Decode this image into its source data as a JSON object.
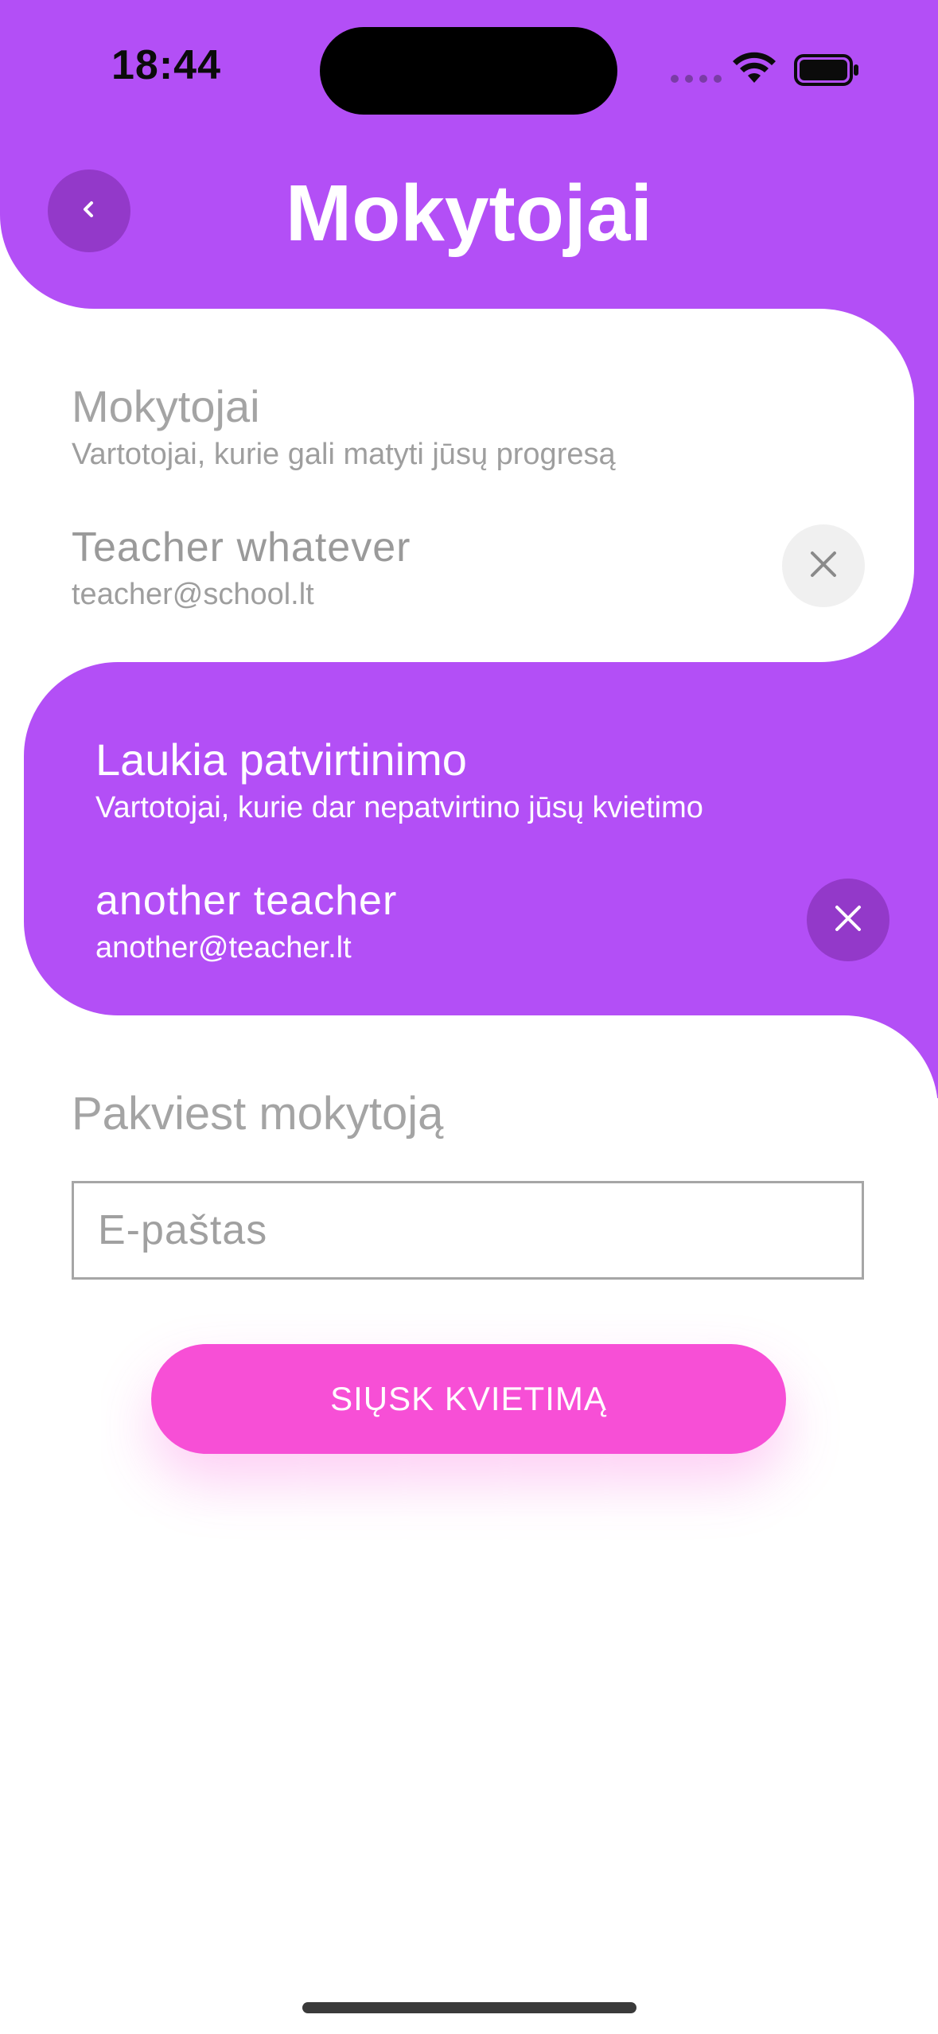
{
  "status_bar": {
    "time": "18:44"
  },
  "header": {
    "title": "Mokytojai",
    "back_icon": "chevron-left-icon"
  },
  "teachers_section": {
    "title": "Mokytojai",
    "subtitle": "Vartotojai, kurie gali matyti jūsų progresą",
    "items": [
      {
        "name": "Teacher whatever",
        "email": "teacher@school.lt",
        "remove_icon": "close-icon"
      }
    ]
  },
  "pending_section": {
    "title": "Laukia patvirtinimo",
    "subtitle": "Vartotojai, kurie dar nepatvirtino jūsų kvietimo",
    "items": [
      {
        "name": "another teacher",
        "email": "another@teacher.lt",
        "remove_icon": "close-icon"
      }
    ]
  },
  "invite_section": {
    "title": "Pakviest mokytoją",
    "email_placeholder": "E-paštas",
    "email_value": "",
    "send_label": "SIŲSK KVIETIMĄ"
  },
  "colors": {
    "accent_purple": "#b34ff6",
    "dark_purple": "#9339c9",
    "pink_button": "#f74fd6"
  }
}
